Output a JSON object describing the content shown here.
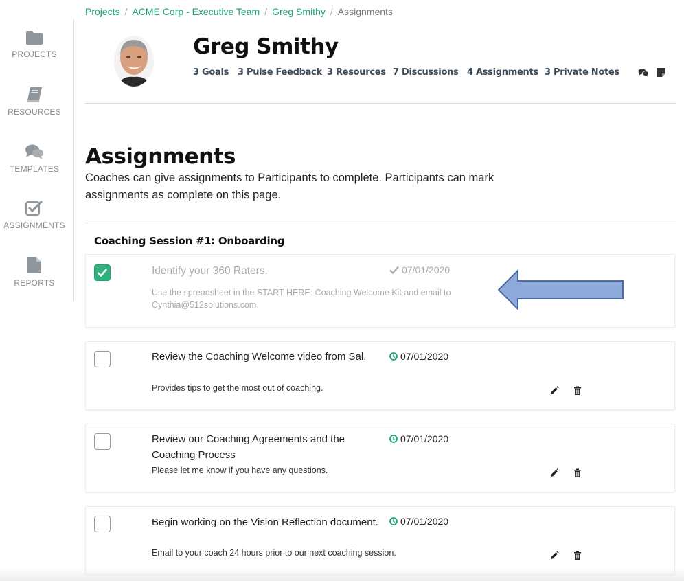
{
  "sidebar": {
    "items": [
      {
        "label": "PROJECTS",
        "icon": "folder-icon"
      },
      {
        "label": "RESOURCES",
        "icon": "book-icon"
      },
      {
        "label": "TEMPLATES",
        "icon": "chat-bubbles-icon"
      },
      {
        "label": "ASSIGNMENTS",
        "icon": "checkbox-icon"
      },
      {
        "label": "REPORTS",
        "icon": "document-icon"
      }
    ]
  },
  "breadcrumb": {
    "items": [
      "Projects",
      "ACME Corp - Executive Team",
      "Greg Smithy"
    ],
    "current": "Assignments",
    "separator": "/"
  },
  "header": {
    "name": "Greg Smithy",
    "stats": [
      "3 Goals",
      "3 Pulse Feedback",
      "3 Resources",
      "7 Discussions",
      "4 Assignments",
      "3 Private Notes"
    ],
    "icons": [
      "comments-icon",
      "note-icon"
    ]
  },
  "section": {
    "title": "Assignments",
    "description": "Coaches can give assignments to Participants to complete. Participants can mark assignments as complete on this page."
  },
  "session": {
    "title": "Coaching Session #1: Onboarding"
  },
  "assignments": [
    {
      "title": "Identify your 360 Raters.",
      "description": "Use the spreadsheet in the START HERE: Coaching Welcome Kit and email to Cynthia@512solutions.com.",
      "date": "07/01/2020",
      "completed": true
    },
    {
      "title": "Review the Coaching Welcome video from Sal.",
      "description": "Provides tips to get the most out of coaching.",
      "date": "07/01/2020",
      "completed": false
    },
    {
      "title": "Review our Coaching Agreements and the Coaching Process",
      "description": "Please let me know if you have any questions.",
      "date": "07/01/2020",
      "completed": false
    },
    {
      "title": "Begin working on the Vision Reflection document.",
      "description": "Email to your coach 24 hours prior to our next coaching session.",
      "date": "07/01/2020",
      "completed": false
    }
  ],
  "colors": {
    "accent": "#1aa57a",
    "checked": "#2fb27f",
    "arrow_fill": "#8eaadb",
    "arrow_stroke": "#3f5f95"
  }
}
